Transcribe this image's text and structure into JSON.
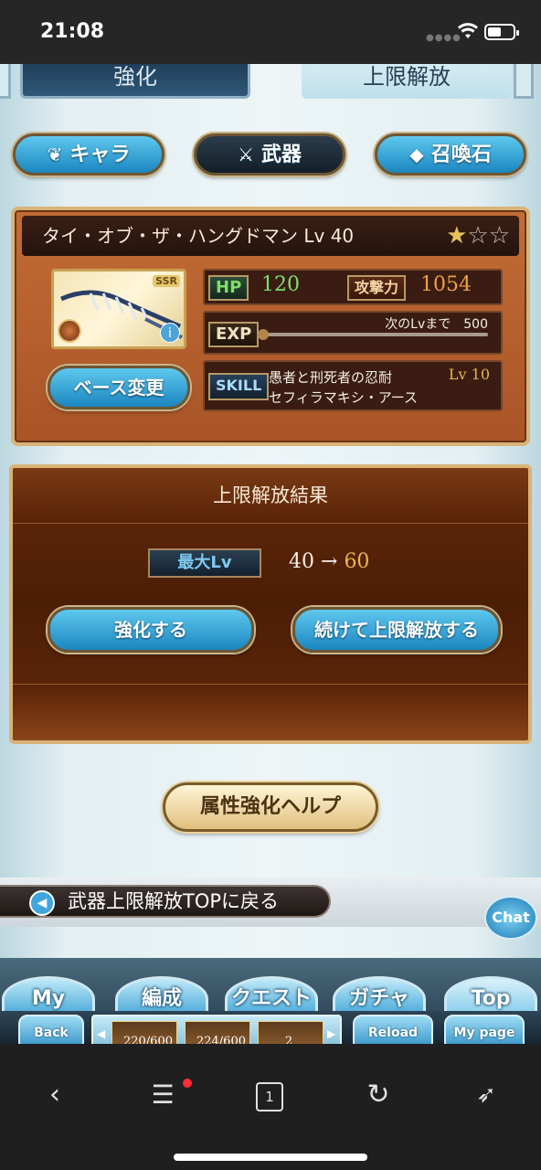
{
  "status_bar": {
    "time": "21:08"
  },
  "tabs": {
    "enhance": "強化",
    "limit_break": "上限解放"
  },
  "category": {
    "chara": "キャラ",
    "weapon": "武器",
    "summon": "召喚石"
  },
  "weapon": {
    "name": "タイ・オブ・ザ・ハングドマン Lv 40",
    "rarity_badge": "SSR",
    "stars_filled": 1,
    "stars_total": 3,
    "hp_label": "HP",
    "hp_value": "120",
    "atk_label": "攻撃力",
    "atk_value": "1054",
    "exp_label": "EXP",
    "next_lv_text": "次のLvまで　500",
    "skill_label": "SKILL",
    "skill_name_1": "愚者と刑死者の忍耐",
    "skill_lv": "Lv 10",
    "skill_name_2": "セフィラマキシ・アース",
    "base_change_button": "ベース変更",
    "info_icon": "i"
  },
  "result": {
    "title": "上限解放結果",
    "max_lv_label": "最大Lv",
    "lv_from": "40",
    "lv_arrow": "→",
    "lv_to": "60",
    "enhance_button": "強化する",
    "continue_button": "続けて上限解放する"
  },
  "help_button": "属性強化ヘルプ",
  "back_link": "武器上限解放TOPに戻る",
  "chat_button": "Chat",
  "game_nav": {
    "mypage": "My page",
    "party": "編成",
    "quest": "クエスト",
    "gacha": "ガチャ",
    "top": "Top",
    "back": "Back",
    "reload": "Reload",
    "mypage_small": "My page",
    "items": [
      "220/600",
      "224/600",
      "2"
    ]
  },
  "browser": {
    "tab_count": "1",
    "icons": [
      "back-icon",
      "menu-icon",
      "tabs-icon",
      "reload-icon",
      "rocket-icon"
    ]
  },
  "colors": {
    "hp": "#7ee06a",
    "atk": "#f0a040",
    "lv_to": "#e8b84a",
    "accent_blue": "#1b86c0"
  }
}
